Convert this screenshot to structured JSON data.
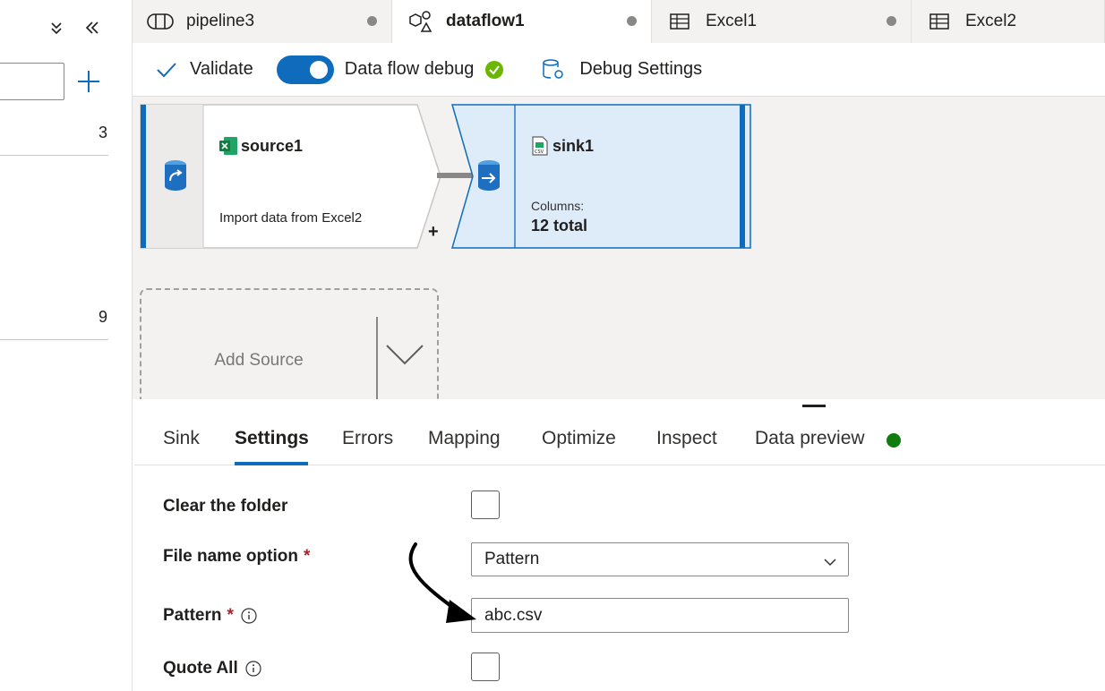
{
  "left_pane": {
    "counts": [
      "3",
      "9"
    ]
  },
  "tabs": [
    {
      "label": "pipeline3",
      "icon": "pipeline-icon",
      "unsaved": true
    },
    {
      "label": "dataflow1",
      "icon": "dataflow-icon",
      "unsaved": true,
      "active": true
    },
    {
      "label": "Excel1",
      "icon": "table-icon",
      "unsaved": true
    },
    {
      "label": "Excel2",
      "icon": "table-icon"
    }
  ],
  "toolbar": {
    "validate_label": "Validate",
    "debug_label": "Data flow debug",
    "debug_enabled": true,
    "debug_settings_label": "Debug Settings"
  },
  "canvas": {
    "source": {
      "title": "source1",
      "description": "Import data from Excel2",
      "icon": "excel-icon"
    },
    "sink": {
      "title": "sink1",
      "columns_label": "Columns:",
      "columns_value": "12 total",
      "icon": "csv-file-icon"
    },
    "add_source_label": "Add Source",
    "add_symbol": "+"
  },
  "panel": {
    "tabs": [
      "Sink",
      "Settings",
      "Errors",
      "Mapping",
      "Optimize",
      "Inspect",
      "Data preview"
    ],
    "active_tab": "Settings",
    "fields": {
      "clear_folder_label": "Clear the folder",
      "clear_folder_checked": false,
      "file_name_option_label": "File name option",
      "file_name_option_value": "Pattern",
      "pattern_label": "Pattern",
      "pattern_value": "abc.csv",
      "quote_all_label": "Quote All",
      "quote_all_checked": false,
      "required_mark": "*"
    }
  },
  "colors": {
    "accent": "#0f6cbd",
    "success": "#107c10",
    "debug_ok": "#6bb700",
    "sink_fill": "#deecf9"
  }
}
